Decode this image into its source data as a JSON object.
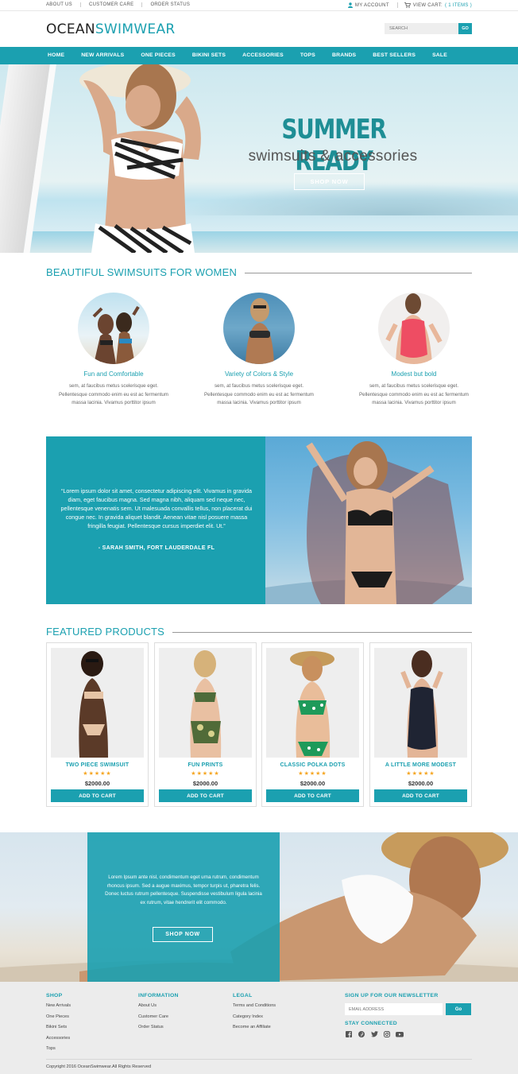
{
  "topbar": {
    "links": [
      "ABOUT US",
      "CUSTOMER CARE",
      "ORDER STATUS"
    ],
    "account": "MY ACCOUNT",
    "cart_label": "VIEW CART:",
    "cart_count": "( 1 ITEMS )"
  },
  "header": {
    "logo_part1": "OCEAN",
    "logo_part2": "SWIMWEAR",
    "search_placeholder": "SEARCH",
    "search_button": "GO"
  },
  "nav": [
    "HOME",
    "NEW ARRIVALS",
    "ONE PIECES",
    "BIKINI SETS",
    "ACCESSORIES",
    "TOPS",
    "BRANDS",
    "BEST SELLERS",
    "SALE"
  ],
  "hero": {
    "title": "SUMMER READY",
    "subtitle": "swimsuits & accessories",
    "button": "SHOP NOW"
  },
  "section1_title": "BEAUTIFUL SWIMSUITS FOR WOMEN",
  "features": [
    {
      "title": "Fun and Comfortable",
      "text": "sem, at faucibus metus scelerisque eget. Pellentesque commodo enim eu est ac fermentum massa lacinia. Vivamus porttitor ipsum"
    },
    {
      "title": "Variety of Colors & Style",
      "text": "sem, at faucibus metus scelerisque eget. Pellentesque commodo enim eu est ac fermentum massa lacinia. Vivamus porttitor ipsum"
    },
    {
      "title": "Modest but bold",
      "text": "sem, at faucibus metus scelerisque eget. Pellentesque commodo enim eu est ac fermentum massa lacinia. Vivamus porttitor ipsum"
    }
  ],
  "testimonial": {
    "quote": "“Lorem ipsum dolor sit amet, consectetur adipiscing elit. Vivamus in gravida diam, eget faucibus magna. Sed magna nibh, aliquam sed neque nec, pellentesque venenatis sem. Ut malesuada convallis tellus, non placerat dui congue nec. In gravida aliquet blandit. Aenean vitae nisl posuere massa fringilla feugiat. Pellentesque cursus imperdiet elit. Ut.”",
    "author": "- SARAH SMITH, FORT LAUDERDALE FL"
  },
  "section2_title": "FEATURED PRODUCTS",
  "products": [
    {
      "name": "TWO PIECE SWIMSUIT",
      "stars": "★★★★★",
      "price": "$2000.00",
      "button": "ADD TO CART"
    },
    {
      "name": "FUN PRINTS",
      "stars": "★★★★★",
      "price": "$2000.00",
      "button": "ADD TO CART"
    },
    {
      "name": "CLASSIC POLKA DOTS",
      "stars": "★★★★★",
      "price": "$2000.00",
      "button": "ADD TO CART"
    },
    {
      "name": "A LITTLE MORE MODEST",
      "stars": "★★★★★",
      "price": "$2000.00",
      "button": "ADD TO CART"
    }
  ],
  "promo": {
    "text": "Lorem Ipsum ante nisl, condimentum eget urna rutrum, condimentum rhoncus ipsum. Sed a augue maximus, tempor turpis ut, pharetra felis. Donec luctus rutrum pellentesque. Suspendisse vestibulum ligula lacinia ex rutrum, vitae hendrerit elit commodo.",
    "button": "SHOP NOW"
  },
  "footer": {
    "shop": {
      "title": "SHOP",
      "links": [
        "New Arrivals",
        "One Pieces",
        "Bikini Sets",
        "Accessories",
        "Tops"
      ]
    },
    "information": {
      "title": "INFORMATION",
      "links": [
        "About Us",
        "Customer Care",
        "Order Status"
      ]
    },
    "legal": {
      "title": "LEGAL",
      "links": [
        "Terms and Conditions",
        "Category Index",
        "Become an Affiliate"
      ]
    },
    "newsletter_title": "SIGN UP FOR OUR NEWSLETTER",
    "email_placeholder": "EMAIL ADDRESS",
    "go": "Go",
    "stay_connected": "STAY CONNECTED",
    "social": [
      "facebook-icon",
      "pinterest-icon",
      "twitter-icon",
      "instagram-icon",
      "youtube-icon"
    ],
    "copyright": "Copyright 2016 OceanSwimwear.All Rights Reserved"
  },
  "colors": {
    "accent": "#1ba0b0",
    "stars": "#f5a623"
  }
}
